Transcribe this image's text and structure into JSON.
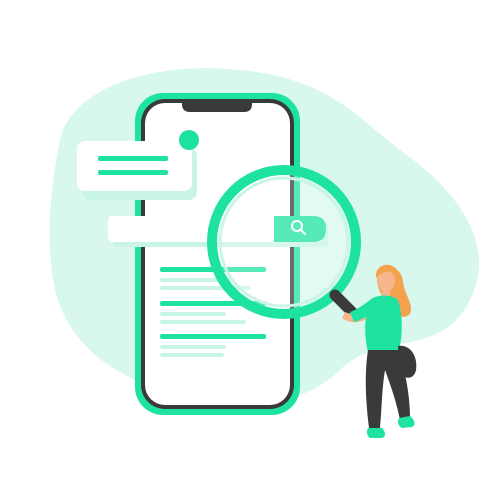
{
  "illustration": {
    "subject": "",
    "colors": {
      "blob": "#d8f8ee",
      "accent": "#1ee3a0",
      "accent_light": "#c9f5e4",
      "phone_frame": "#1ee3a0",
      "phone_bezel": "#3a3a3a",
      "screen": "#ffffff",
      "skin": "#f4b68a",
      "hair": "#f5a24f",
      "shirt": "#1ee3a0",
      "pants": "#3a3a3a",
      "shoe": "#1ee3a0"
    },
    "icons": {
      "search": "search-icon",
      "magnifier": "magnifying-glass-icon"
    }
  }
}
